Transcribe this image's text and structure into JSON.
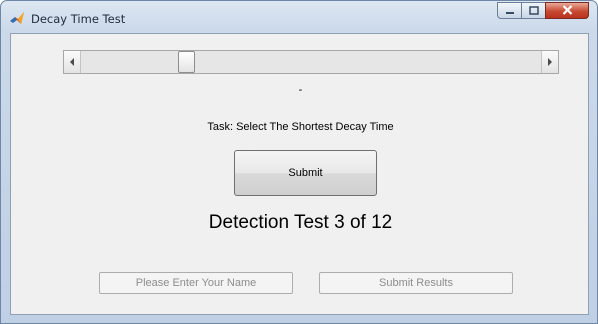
{
  "window": {
    "title": "Decay Time Test"
  },
  "icons": {
    "app": "matlab-icon",
    "minimize": "minimize-icon",
    "maximize": "maximize-icon",
    "close": "close-icon",
    "scroll_left": "arrow-left-icon",
    "scroll_right": "arrow-right-icon"
  },
  "slider": {
    "value_fraction": 0.22
  },
  "value_text": "-",
  "task_text": "Task: Select The Shortest Decay Time",
  "submit_label": "Submit",
  "detection_text": "Detection Test 3 of 12",
  "name_button_label": "Please Enter Your Name",
  "results_button_label": "Submit Results",
  "colors": {
    "close_button": "#c74a32",
    "disabled_text": "#8d8d8d"
  }
}
